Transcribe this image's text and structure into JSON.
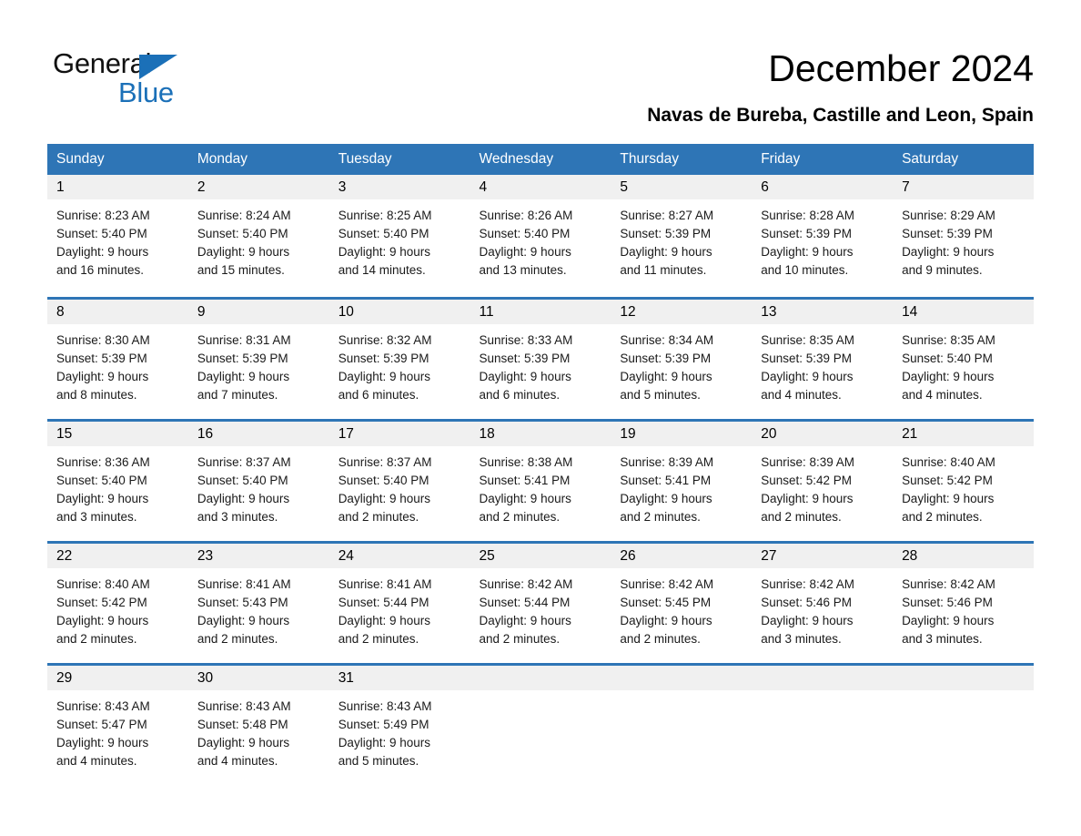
{
  "brand": {
    "name_part1": "General",
    "name_part2": "Blue",
    "triangle_color": "#1b70b8"
  },
  "header": {
    "title": "December 2024",
    "subtitle": "Navas de Bureba, Castille and Leon, Spain"
  },
  "theme": {
    "header_blue": "#2e75b6",
    "daynum_band": "#f0f0f0",
    "row_divider": "#2e75b6"
  },
  "calendar": {
    "weekdays": [
      "Sunday",
      "Monday",
      "Tuesday",
      "Wednesday",
      "Thursday",
      "Friday",
      "Saturday"
    ],
    "weeks": [
      [
        {
          "day": "1",
          "sunrise": "Sunrise: 8:23 AM",
          "sunset": "Sunset: 5:40 PM",
          "daylight1": "Daylight: 9 hours",
          "daylight2": "and 16 minutes."
        },
        {
          "day": "2",
          "sunrise": "Sunrise: 8:24 AM",
          "sunset": "Sunset: 5:40 PM",
          "daylight1": "Daylight: 9 hours",
          "daylight2": "and 15 minutes."
        },
        {
          "day": "3",
          "sunrise": "Sunrise: 8:25 AM",
          "sunset": "Sunset: 5:40 PM",
          "daylight1": "Daylight: 9 hours",
          "daylight2": "and 14 minutes."
        },
        {
          "day": "4",
          "sunrise": "Sunrise: 8:26 AM",
          "sunset": "Sunset: 5:40 PM",
          "daylight1": "Daylight: 9 hours",
          "daylight2": "and 13 minutes."
        },
        {
          "day": "5",
          "sunrise": "Sunrise: 8:27 AM",
          "sunset": "Sunset: 5:39 PM",
          "daylight1": "Daylight: 9 hours",
          "daylight2": "and 11 minutes."
        },
        {
          "day": "6",
          "sunrise": "Sunrise: 8:28 AM",
          "sunset": "Sunset: 5:39 PM",
          "daylight1": "Daylight: 9 hours",
          "daylight2": "and 10 minutes."
        },
        {
          "day": "7",
          "sunrise": "Sunrise: 8:29 AM",
          "sunset": "Sunset: 5:39 PM",
          "daylight1": "Daylight: 9 hours",
          "daylight2": "and 9 minutes."
        }
      ],
      [
        {
          "day": "8",
          "sunrise": "Sunrise: 8:30 AM",
          "sunset": "Sunset: 5:39 PM",
          "daylight1": "Daylight: 9 hours",
          "daylight2": "and 8 minutes."
        },
        {
          "day": "9",
          "sunrise": "Sunrise: 8:31 AM",
          "sunset": "Sunset: 5:39 PM",
          "daylight1": "Daylight: 9 hours",
          "daylight2": "and 7 minutes."
        },
        {
          "day": "10",
          "sunrise": "Sunrise: 8:32 AM",
          "sunset": "Sunset: 5:39 PM",
          "daylight1": "Daylight: 9 hours",
          "daylight2": "and 6 minutes."
        },
        {
          "day": "11",
          "sunrise": "Sunrise: 8:33 AM",
          "sunset": "Sunset: 5:39 PM",
          "daylight1": "Daylight: 9 hours",
          "daylight2": "and 6 minutes."
        },
        {
          "day": "12",
          "sunrise": "Sunrise: 8:34 AM",
          "sunset": "Sunset: 5:39 PM",
          "daylight1": "Daylight: 9 hours",
          "daylight2": "and 5 minutes."
        },
        {
          "day": "13",
          "sunrise": "Sunrise: 8:35 AM",
          "sunset": "Sunset: 5:39 PM",
          "daylight1": "Daylight: 9 hours",
          "daylight2": "and 4 minutes."
        },
        {
          "day": "14",
          "sunrise": "Sunrise: 8:35 AM",
          "sunset": "Sunset: 5:40 PM",
          "daylight1": "Daylight: 9 hours",
          "daylight2": "and 4 minutes."
        }
      ],
      [
        {
          "day": "15",
          "sunrise": "Sunrise: 8:36 AM",
          "sunset": "Sunset: 5:40 PM",
          "daylight1": "Daylight: 9 hours",
          "daylight2": "and 3 minutes."
        },
        {
          "day": "16",
          "sunrise": "Sunrise: 8:37 AM",
          "sunset": "Sunset: 5:40 PM",
          "daylight1": "Daylight: 9 hours",
          "daylight2": "and 3 minutes."
        },
        {
          "day": "17",
          "sunrise": "Sunrise: 8:37 AM",
          "sunset": "Sunset: 5:40 PM",
          "daylight1": "Daylight: 9 hours",
          "daylight2": "and 2 minutes."
        },
        {
          "day": "18",
          "sunrise": "Sunrise: 8:38 AM",
          "sunset": "Sunset: 5:41 PM",
          "daylight1": "Daylight: 9 hours",
          "daylight2": "and 2 minutes."
        },
        {
          "day": "19",
          "sunrise": "Sunrise: 8:39 AM",
          "sunset": "Sunset: 5:41 PM",
          "daylight1": "Daylight: 9 hours",
          "daylight2": "and 2 minutes."
        },
        {
          "day": "20",
          "sunrise": "Sunrise: 8:39 AM",
          "sunset": "Sunset: 5:42 PM",
          "daylight1": "Daylight: 9 hours",
          "daylight2": "and 2 minutes."
        },
        {
          "day": "21",
          "sunrise": "Sunrise: 8:40 AM",
          "sunset": "Sunset: 5:42 PM",
          "daylight1": "Daylight: 9 hours",
          "daylight2": "and 2 minutes."
        }
      ],
      [
        {
          "day": "22",
          "sunrise": "Sunrise: 8:40 AM",
          "sunset": "Sunset: 5:42 PM",
          "daylight1": "Daylight: 9 hours",
          "daylight2": "and 2 minutes."
        },
        {
          "day": "23",
          "sunrise": "Sunrise: 8:41 AM",
          "sunset": "Sunset: 5:43 PM",
          "daylight1": "Daylight: 9 hours",
          "daylight2": "and 2 minutes."
        },
        {
          "day": "24",
          "sunrise": "Sunrise: 8:41 AM",
          "sunset": "Sunset: 5:44 PM",
          "daylight1": "Daylight: 9 hours",
          "daylight2": "and 2 minutes."
        },
        {
          "day": "25",
          "sunrise": "Sunrise: 8:42 AM",
          "sunset": "Sunset: 5:44 PM",
          "daylight1": "Daylight: 9 hours",
          "daylight2": "and 2 minutes."
        },
        {
          "day": "26",
          "sunrise": "Sunrise: 8:42 AM",
          "sunset": "Sunset: 5:45 PM",
          "daylight1": "Daylight: 9 hours",
          "daylight2": "and 2 minutes."
        },
        {
          "day": "27",
          "sunrise": "Sunrise: 8:42 AM",
          "sunset": "Sunset: 5:46 PM",
          "daylight1": "Daylight: 9 hours",
          "daylight2": "and 3 minutes."
        },
        {
          "day": "28",
          "sunrise": "Sunrise: 8:42 AM",
          "sunset": "Sunset: 5:46 PM",
          "daylight1": "Daylight: 9 hours",
          "daylight2": "and 3 minutes."
        }
      ],
      [
        {
          "day": "29",
          "sunrise": "Sunrise: 8:43 AM",
          "sunset": "Sunset: 5:47 PM",
          "daylight1": "Daylight: 9 hours",
          "daylight2": "and 4 minutes."
        },
        {
          "day": "30",
          "sunrise": "Sunrise: 8:43 AM",
          "sunset": "Sunset: 5:48 PM",
          "daylight1": "Daylight: 9 hours",
          "daylight2": "and 4 minutes."
        },
        {
          "day": "31",
          "sunrise": "Sunrise: 8:43 AM",
          "sunset": "Sunset: 5:49 PM",
          "daylight1": "Daylight: 9 hours",
          "daylight2": "and 5 minutes."
        },
        {
          "day": "",
          "sunrise": "",
          "sunset": "",
          "daylight1": "",
          "daylight2": ""
        },
        {
          "day": "",
          "sunrise": "",
          "sunset": "",
          "daylight1": "",
          "daylight2": ""
        },
        {
          "day": "",
          "sunrise": "",
          "sunset": "",
          "daylight1": "",
          "daylight2": ""
        },
        {
          "day": "",
          "sunrise": "",
          "sunset": "",
          "daylight1": "",
          "daylight2": ""
        }
      ]
    ]
  }
}
